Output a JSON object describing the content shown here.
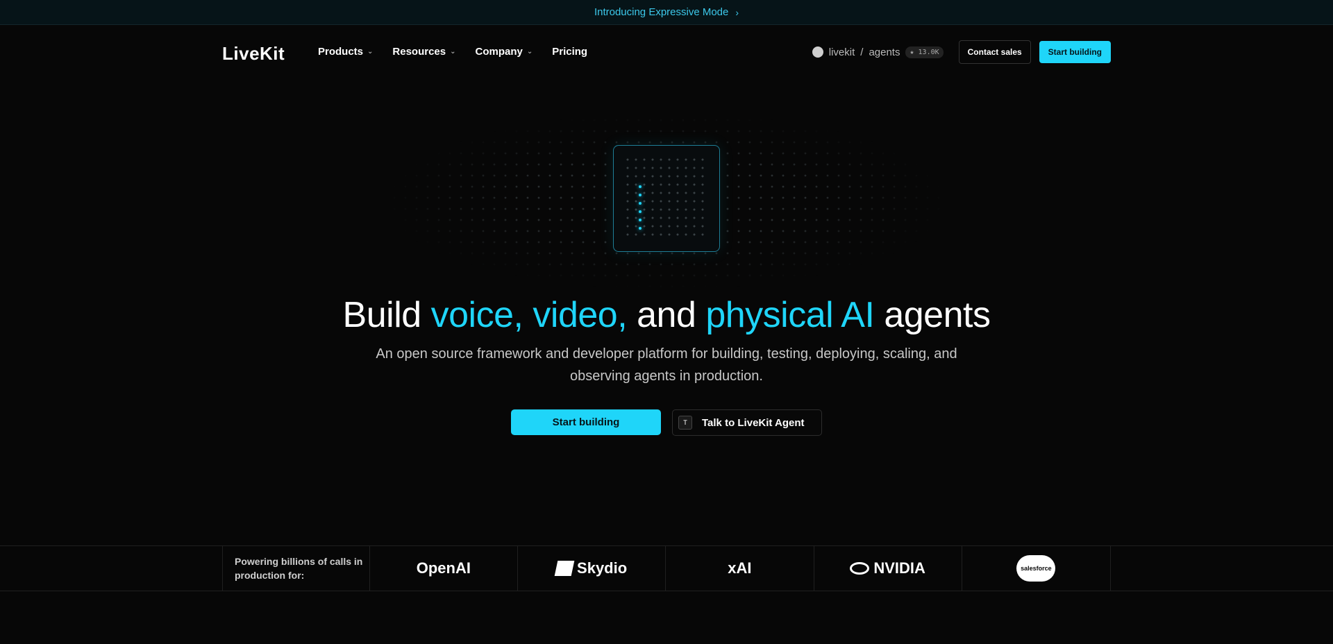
{
  "announcement": {
    "text": "Introducing Expressive Mode",
    "chevron": "›"
  },
  "nav": {
    "logo": "LiveKit",
    "items": [
      {
        "label": "Products",
        "has_caret": true
      },
      {
        "label": "Resources",
        "has_caret": true
      },
      {
        "label": "Company",
        "has_caret": true
      },
      {
        "label": "Pricing",
        "has_caret": false
      }
    ],
    "caret": "⌄",
    "repo": {
      "icon": "github-icon",
      "owner": "livekit",
      "separator": "/",
      "name": "agents",
      "stars": "★ 13.0K"
    },
    "contact_label": "Contact sales",
    "start_label": "Start building"
  },
  "hero": {
    "headline": {
      "part1": "Build ",
      "hl1": "voice, video,",
      "part2": " and ",
      "hl2": "physical AI",
      "part3": " agents"
    },
    "subtitle": "An open source framework and developer platform for building, testing, deploying, scaling, and observing agents in production.",
    "primary_cta": "Start building",
    "secondary_cta": "Talk to LiveKit Agent",
    "shortcut_key": "T"
  },
  "logos": {
    "label": "Powering billions of calls in production for:",
    "items": [
      "OpenAI",
      "Skydio",
      "xAI",
      "NVIDIA",
      "salesforce"
    ]
  },
  "colors": {
    "accent": "#1fd5f9",
    "background": "#070707"
  }
}
